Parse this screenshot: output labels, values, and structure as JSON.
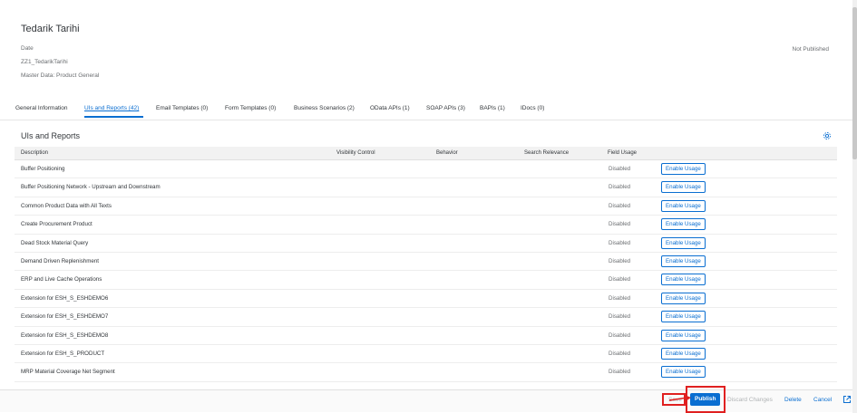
{
  "header": {
    "title": "Tedarik Tarihi",
    "type": "Date",
    "name": "ZZ1_TedarikTarihi",
    "business_context": "Master Data: Product General",
    "status": "Not Published"
  },
  "tabs": [
    {
      "label": "General Information"
    },
    {
      "label": "UIs and Reports (42)"
    },
    {
      "label": "Email Templates (0)"
    },
    {
      "label": "Form Templates (0)"
    },
    {
      "label": "Business Scenarios (2)"
    },
    {
      "label": "OData APIs (1)"
    },
    {
      "label": "SOAP APIs (3)"
    },
    {
      "label": "BAPIs (1)"
    },
    {
      "label": "IDocs (0)"
    }
  ],
  "section": {
    "title": "UIs and Reports",
    "settings_icon": "gear-icon"
  },
  "table": {
    "columns": [
      "Description",
      "Visibility Control",
      "Behavior",
      "Search Relevance",
      "Field Usage"
    ],
    "rows": [
      {
        "description": "Buffer Positioning",
        "field_usage": "Disabled",
        "action": "Enable Usage"
      },
      {
        "description": "Buffer Positioning Network - Upstream and Downstream",
        "field_usage": "Disabled",
        "action": "Enable Usage"
      },
      {
        "description": "Common Product Data with All Texts",
        "field_usage": "Disabled",
        "action": "Enable Usage"
      },
      {
        "description": "Create Procurement Product",
        "field_usage": "Disabled",
        "action": "Enable Usage"
      },
      {
        "description": "Dead Stock Material Query",
        "field_usage": "Disabled",
        "action": "Enable Usage"
      },
      {
        "description": "Demand Driven Replenishment",
        "field_usage": "Disabled",
        "action": "Enable Usage"
      },
      {
        "description": "ERP and Live Cache Operations",
        "field_usage": "Disabled",
        "action": "Enable Usage"
      },
      {
        "description": "Extension for ESH_S_ESHDEMO6",
        "field_usage": "Disabled",
        "action": "Enable Usage"
      },
      {
        "description": "Extension for ESH_S_ESHDEMO7",
        "field_usage": "Disabled",
        "action": "Enable Usage"
      },
      {
        "description": "Extension for ESH_S_ESHDEMO8",
        "field_usage": "Disabled",
        "action": "Enable Usage"
      },
      {
        "description": "Extension for ESH_S_PRODUCT",
        "field_usage": "Disabled",
        "action": "Enable Usage"
      },
      {
        "description": "MRP Material Coverage Net Segment",
        "field_usage": "Disabled",
        "action": "Enable Usage"
      }
    ]
  },
  "footer": {
    "save": "Save",
    "publish": "Publish",
    "discard": "Discard Changes",
    "delete": "Delete",
    "cancel": "Cancel",
    "external_icon": "external-link-icon"
  },
  "colors": {
    "accent": "#0a6ed1",
    "highlight": "#e02020"
  }
}
